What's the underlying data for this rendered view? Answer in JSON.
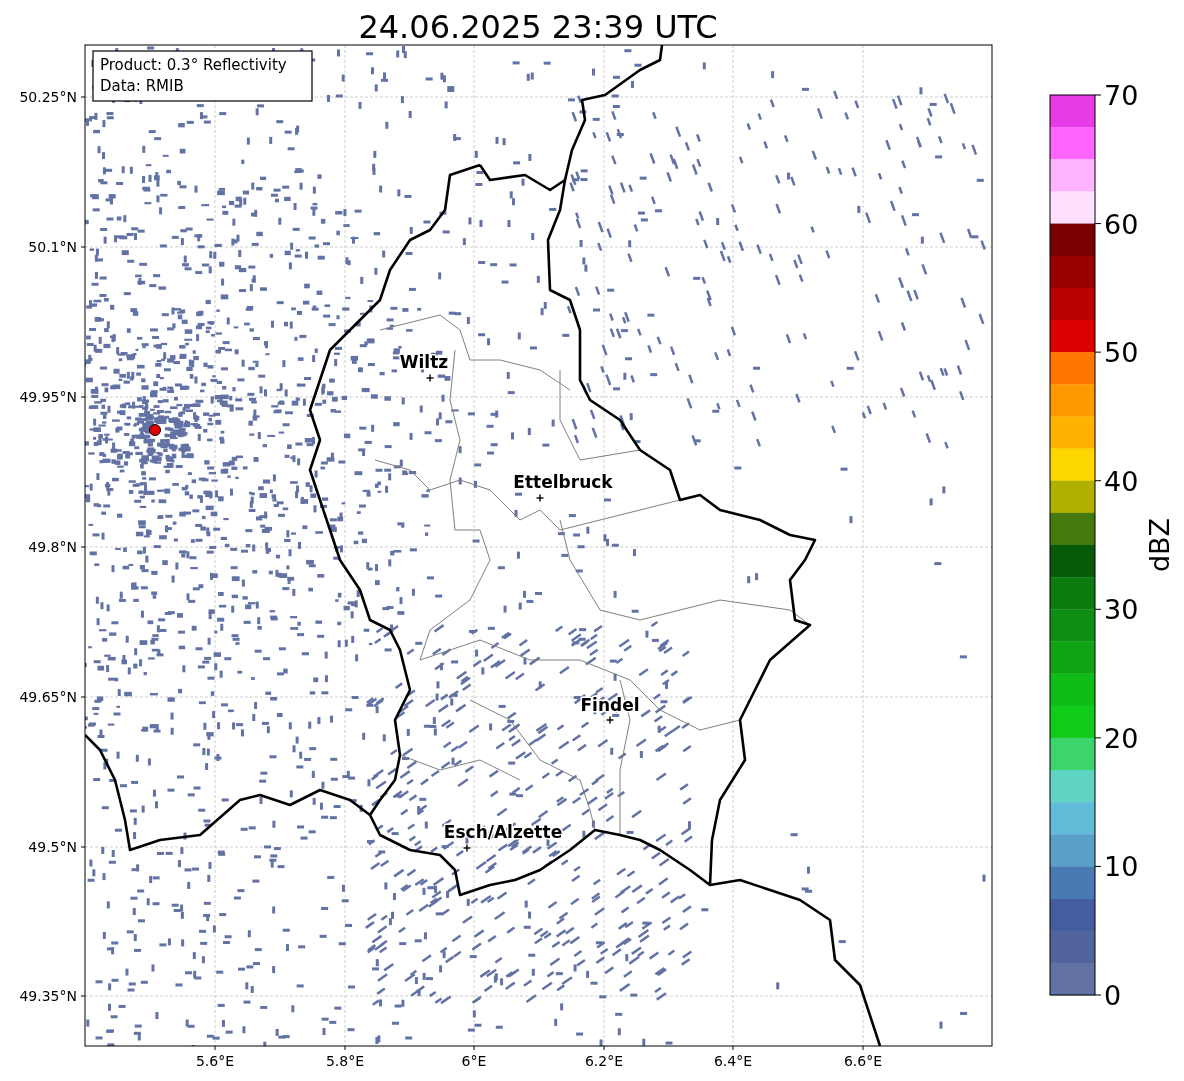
{
  "title": "24.06.2025 23:39 UTC",
  "legend": [
    "Product: 0.3° Reflectivity",
    "Data: RMIB"
  ],
  "y_ticks": [
    "50.25°N",
    "50.1°N",
    "49.95°N",
    "49.8°N",
    "49.65°N",
    "49.5°N",
    "49.35°N"
  ],
  "x_ticks": [
    "5.6°E",
    "5.8°E",
    "6°E",
    "6.2°E",
    "6.4°E",
    "6.6°E"
  ],
  "cities": [
    {
      "name": "Wiltz"
    },
    {
      "name": "Ettelbruck"
    },
    {
      "name": "Findel"
    },
    {
      "name": "Esch/Alzette"
    }
  ],
  "colorbar": {
    "label": "dBZ",
    "ticks": [
      "70",
      "60",
      "50",
      "40",
      "30",
      "20",
      "10",
      "0"
    ],
    "bands": [
      {
        "color": "#e83be8"
      },
      {
        "color": "#ff66ff"
      },
      {
        "color": "#ffb3ff"
      },
      {
        "color": "#ffe0ff"
      },
      {
        "color": "#7a0000"
      },
      {
        "color": "#990000"
      },
      {
        "color": "#bb0000"
      },
      {
        "color": "#dd0000"
      },
      {
        "color": "#ff7700"
      },
      {
        "color": "#ff9900"
      },
      {
        "color": "#ffb300"
      },
      {
        "color": "#ffd700"
      },
      {
        "color": "#b0b000"
      },
      {
        "color": "#447a0c"
      },
      {
        "color": "#065a08"
      },
      {
        "color": "#0c7c0e"
      },
      {
        "color": "#0e8e12"
      },
      {
        "color": "#10a414"
      },
      {
        "color": "#10bc18"
      },
      {
        "color": "#10cc18"
      },
      {
        "color": "#3cd46c"
      },
      {
        "color": "#60d4c4"
      },
      {
        "color": "#60bcd8"
      },
      {
        "color": "#58a0c8"
      },
      {
        "color": "#4a7ab4"
      },
      {
        "color": "#425ea0"
      },
      {
        "color": "#52649c"
      },
      {
        "color": "#6272a4"
      }
    ]
  }
}
